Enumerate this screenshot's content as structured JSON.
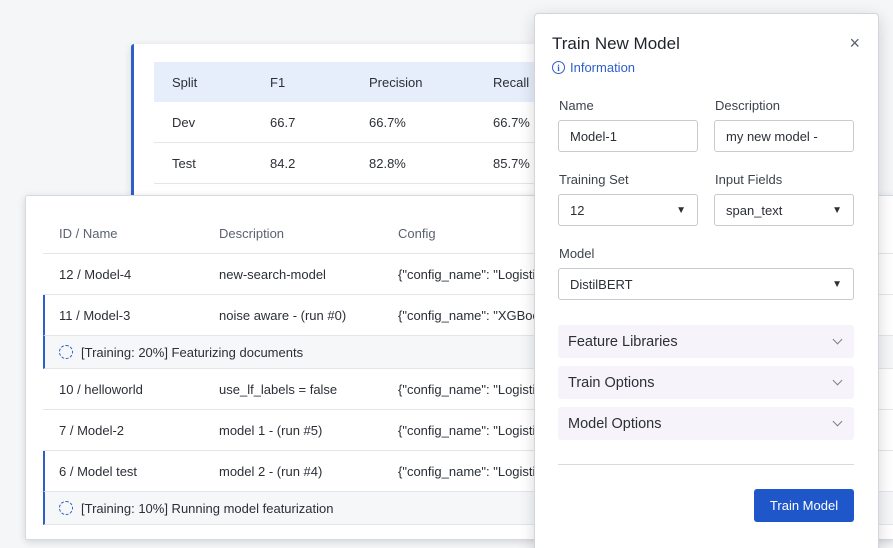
{
  "metrics": {
    "headers": [
      "Split",
      "F1",
      "Precision",
      "Recall"
    ],
    "rows": [
      [
        "Dev",
        "66.7",
        "66.7%",
        "66.7%"
      ],
      [
        "Test",
        "84.2",
        "82.8%",
        "85.7%"
      ]
    ]
  },
  "models": {
    "headers": [
      "ID / Name",
      "Description",
      "Config"
    ],
    "rows": [
      {
        "id": "12 / Model-4",
        "desc": "new-search-model",
        "config": "{\"config_name\": \"Logisti"
      },
      {
        "id": "11 / Model-3",
        "desc": "noise aware - (run #0)",
        "config": "{\"config_name\": \"XGBoo"
      },
      {
        "id": "10 / helloworld",
        "desc": "use_lf_labels = false",
        "config": "{\"config_name\": \"Logisti"
      },
      {
        "id": "7 / Model-2",
        "desc": "model 1 - (run #5)",
        "config": "{\"config_name\": \"Logisti"
      },
      {
        "id": "6 / Model test",
        "desc": "model 2 - (run #4)",
        "config": "{\"config_name\": \"Logisti"
      }
    ],
    "status_1": "[Training: 20%]  Featurizing documents",
    "status_2": "[Training: 10%]  Running model featurization"
  },
  "modal": {
    "title": "Train New Model",
    "close": "×",
    "info": "Information",
    "name_label": "Name",
    "name_value": "Model-1",
    "description_label": "Description",
    "description_value": "my new model -",
    "training_set_label": "Training Set",
    "training_set_value": "12",
    "input_fields_label": "Input Fields",
    "input_fields_value": "span_text",
    "model_label": "Model",
    "model_value": "DistilBERT",
    "accordions": [
      "Feature Libraries",
      "Train Options",
      "Model Options"
    ],
    "train_button": "Train Model"
  },
  "colors": {
    "accent": "#1f56c9",
    "header_bg": "#e6eefc",
    "accordion_bg": "#f7f3fb"
  }
}
